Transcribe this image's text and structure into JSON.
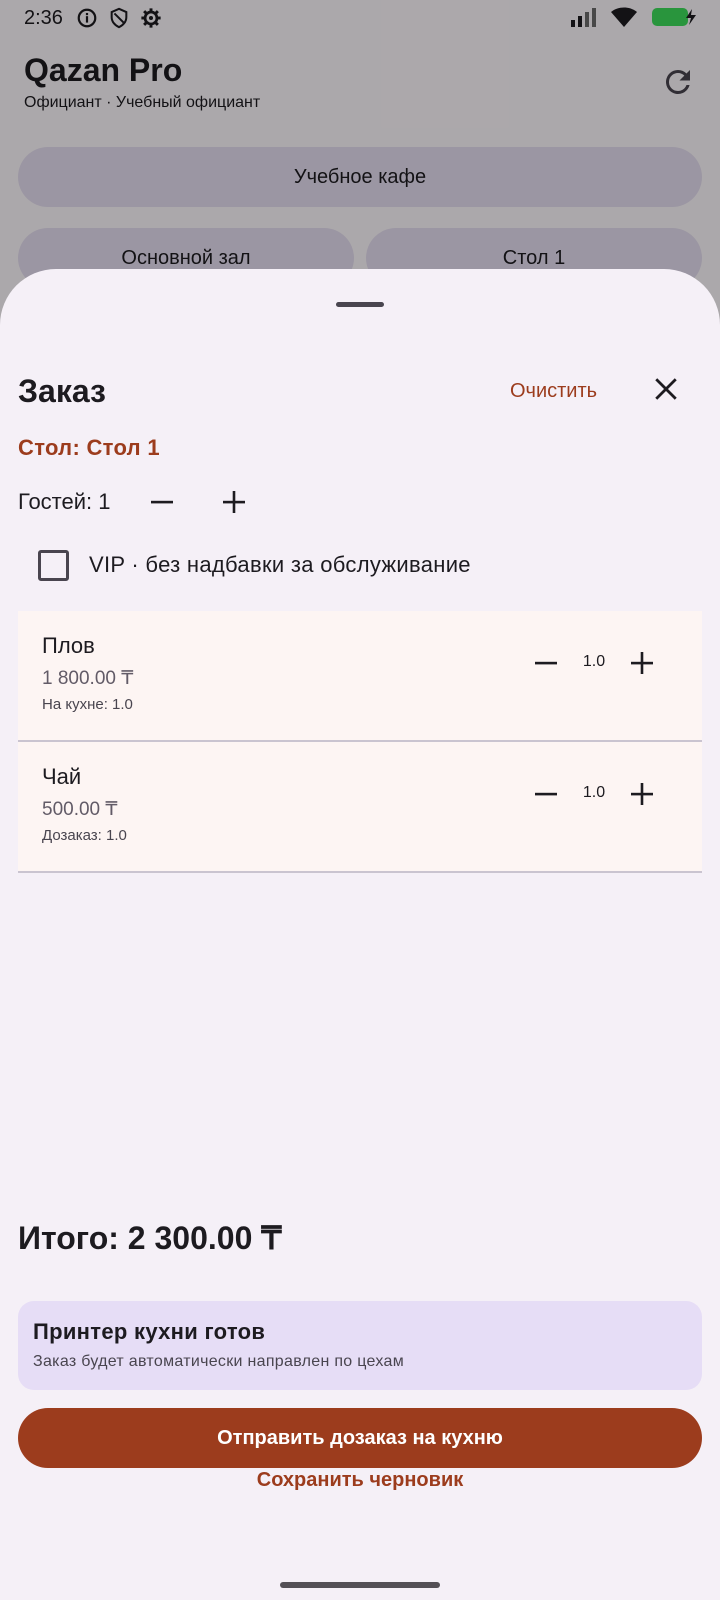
{
  "status_bar": {
    "time": "2:36",
    "icons_left": [
      "info-icon",
      "shield-icon",
      "settings-icon"
    ],
    "icons_right": [
      "signal-icon",
      "wifi-icon",
      "battery-charging-icon"
    ]
  },
  "header": {
    "title": "Qazan Pro",
    "subtitle": "Официант · Учебный официант"
  },
  "selectors": {
    "cafe": "Учебное кафе",
    "hall": "Основной зал",
    "table": "Стол 1"
  },
  "sheet": {
    "title": "Заказ",
    "clear_label": "Очистить",
    "table_label": "Стол: Стол 1",
    "guests_label": "Гостей: 1",
    "vip_label": "VIP · без надбавки за обслуживание",
    "vip_checked": false,
    "items": [
      {
        "name": "Плов",
        "price": "1 800.00 ₸",
        "note": "На кухне: 1.0",
        "qty": "1.0"
      },
      {
        "name": "Чай",
        "price": "500.00 ₸",
        "note": "Дозаказ: 1.0",
        "qty": "1.0"
      }
    ],
    "total": "Итого: 2 300.00 ₸",
    "printer": {
      "title": "Принтер кухни готов",
      "subtitle": "Заказ будет автоматически направлен по цехам"
    },
    "send_label": "Отправить дозаказ на кухню",
    "draft_label": "Сохранить черновик"
  },
  "colors": {
    "accent": "#9c3c1d",
    "sheet_bg": "#f5f0f7",
    "item_bg": "#fdf5f3",
    "printer_card_bg": "#e6ddf6",
    "battery": "#3ddc5a"
  }
}
